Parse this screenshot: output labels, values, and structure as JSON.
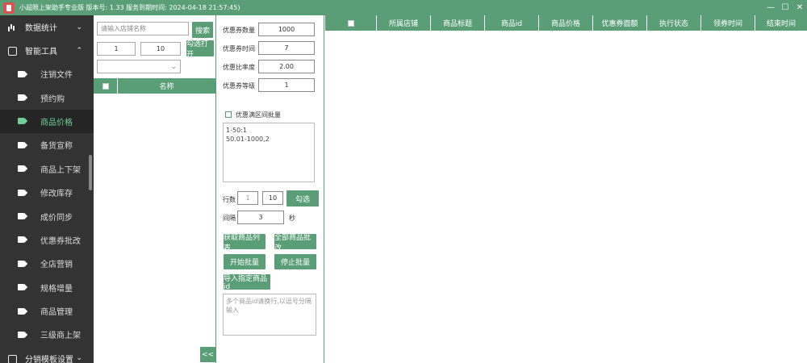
{
  "window": {
    "title": "小超限上架助手专业版 版本号: 1.33  服务到期时间: 2024-04-18 21:57:45)",
    "min": "—",
    "max": "☐",
    "close": "✕"
  },
  "sidebar": {
    "group1": {
      "label": "数据统计",
      "icon": "bar-chart-icon",
      "chevron": "⌄"
    },
    "group2": {
      "label": "智能工具",
      "icon": "box-icon",
      "chevron": "⌃"
    },
    "items": [
      "注销文件",
      "预约购",
      "商品价格",
      "备货宣称",
      "商品上下架",
      "修改库存",
      "成价同步",
      "优惠券批改",
      "全店营销",
      "规格增量",
      "商品管理",
      "三级商上架"
    ],
    "active_index": 2,
    "group3": {
      "label": "分销模板设置",
      "chevron": "⌄"
    }
  },
  "panel1": {
    "search_placeholder": "请输入店铺名称",
    "search_button": "搜索",
    "page_from": "1",
    "page_to": "10",
    "select_button": "勾选打开",
    "dropdown_value": "",
    "table_header": "名称",
    "collapse": "<<"
  },
  "panel2": {
    "fields": [
      {
        "label": "优惠券数量",
        "value": "1000"
      },
      {
        "label": "优惠券时间",
        "value": "7"
      },
      {
        "label": "优惠比率度",
        "value": "2.00"
      },
      {
        "label": "优惠券等级",
        "value": "1"
      }
    ],
    "checkbox_label": "优惠满区间批量",
    "range_text_line1": "1-50:1",
    "range_text_line2": "50.01-1000,2",
    "row_label": "行数",
    "row_from": "1",
    "row_to": "10",
    "row_button": "勾选",
    "interval_label": "间隔",
    "interval_value": "3",
    "interval_unit": "秒",
    "buttons": [
      "获取商品列表",
      "全部商品批改",
      "开始批量",
      "停止批量"
    ],
    "import_button": "导入指定商品id",
    "import_placeholder": "多个商品id请换行,以逗号分隔输入"
  },
  "main": {
    "columns": [
      "所属店铺",
      "商品标题",
      "商品id",
      "商品价格",
      "优惠券面额",
      "执行状态",
      "领券时间",
      "结束时间"
    ]
  }
}
